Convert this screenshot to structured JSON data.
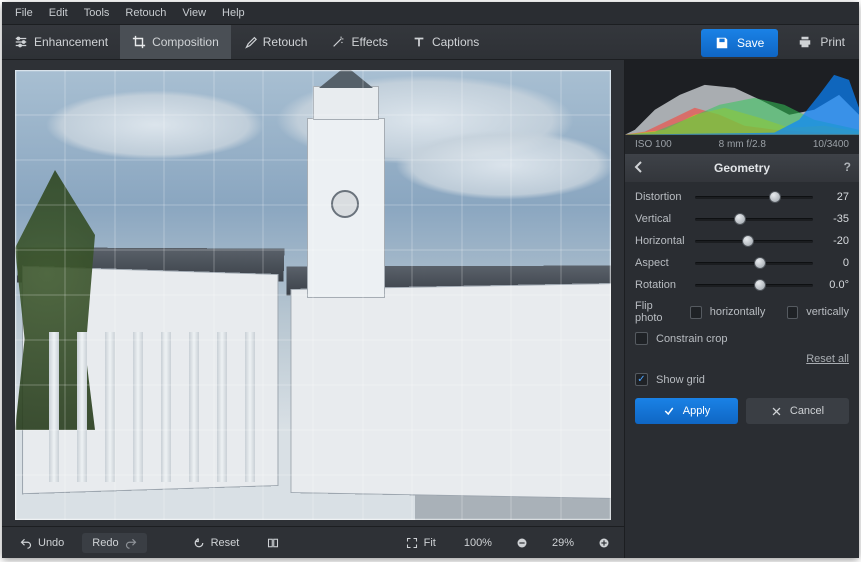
{
  "menubar": [
    "File",
    "Edit",
    "Tools",
    "Retouch",
    "View",
    "Help"
  ],
  "tabs": [
    {
      "id": "enhancement",
      "label": "Enhancement"
    },
    {
      "id": "composition",
      "label": "Composition"
    },
    {
      "id": "retouch",
      "label": "Retouch"
    },
    {
      "id": "effects",
      "label": "Effects"
    },
    {
      "id": "captions",
      "label": "Captions"
    }
  ],
  "active_tab": "composition",
  "save_label": "Save",
  "print_label": "Print",
  "bottom": {
    "undo": "Undo",
    "redo": "Redo",
    "reset": "Reset",
    "fit": "Fit",
    "zoom100": "100%",
    "zoom_value": "29%"
  },
  "meta": {
    "iso": "ISO 100",
    "lens": "8 mm f/2.8",
    "shutter": "10/3400"
  },
  "panel": {
    "title": "Geometry",
    "sliders": {
      "distortion": {
        "label": "Distortion",
        "value": "27",
        "pos": 63
      },
      "vertical": {
        "label": "Vertical",
        "value": "-35",
        "pos": 33
      },
      "horizontal": {
        "label": "Horizontal",
        "value": "-20",
        "pos": 40
      },
      "aspect": {
        "label": "Aspect",
        "value": "0",
        "pos": 50
      },
      "rotation": {
        "label": "Rotation",
        "value": "0.0°",
        "pos": 50
      }
    },
    "flip_label": "Flip photo",
    "flip_h": "horizontally",
    "flip_v": "vertically",
    "constrain": "Constrain crop",
    "show_grid": "Show grid",
    "show_grid_checked": true,
    "reset_all": "Reset all",
    "apply": "Apply",
    "cancel": "Cancel"
  }
}
